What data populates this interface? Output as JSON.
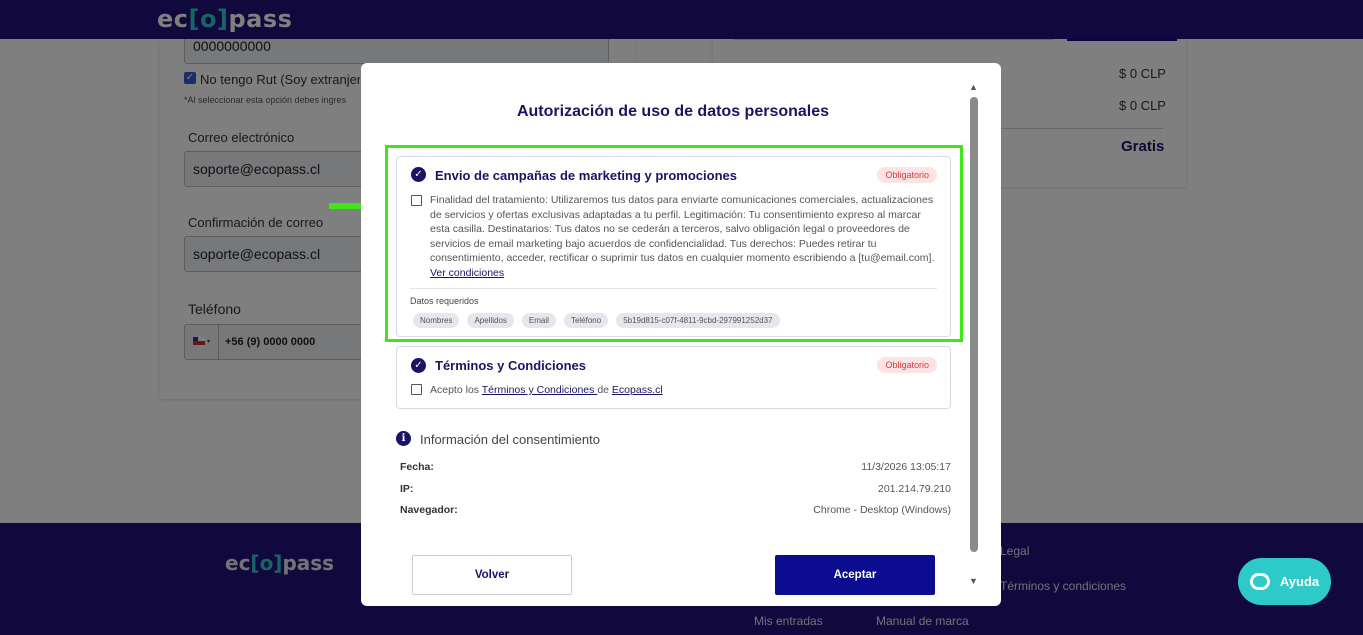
{
  "header": {
    "logo_prefix": "ec",
    "logo_bracket": "[o]",
    "logo_suffix": "pass"
  },
  "background_form": {
    "rut_value": "0000000000",
    "no_rut_label": "No tengo Rut (Soy extranjer",
    "no_rut_note": "*Al seleccionar esta opción debes ingres",
    "email_label": "Correo electrónico",
    "email_value": "soporte@ecopass.cl",
    "email_confirm_label": "Confirmación de correo",
    "email_confirm_value": "soporte@ecopass.cl",
    "phone_label": "Teléfono",
    "phone_value": "+56 (9) 0000 0000"
  },
  "summary": {
    "price_1": "$ 0 CLP",
    "price_2": "$ 0 CLP",
    "total": "Gratis"
  },
  "footer": {
    "logo_prefix": "ec",
    "logo_bracket": "[o]",
    "logo_suffix": "pass",
    "legal_heading": "Legal",
    "terms_link": "Términos y condiciones",
    "my_tickets_link": "Mis entradas",
    "brand_manual_link": "Manual de marca"
  },
  "help_button": {
    "label": "Ayuda"
  },
  "modal": {
    "title": "Autorización de uso de datos personales",
    "marketing": {
      "title": "Envio de campañas de marketing y promociones",
      "badge": "Obligatorio",
      "description": "Finalidad del tratamiento: Utilizaremos tus datos para enviarte comunicaciones comerciales, actualizaciones de servicios y ofertas exclusivas adaptadas a tu perfil. Legitimación: Tu consentimiento expreso al marcar esta casilla. Destinatarios: Tus datos no se cederán a terceros, salvo obligación legal o proveedores de servicios de email marketing bajo acuerdos de confidencialidad. Tus derechos: Puedes retirar tu consentimiento, acceder, rectificar o suprimir tus datos en cualquier momento escribiendo a [tu@email.com].",
      "link": "Ver condiciones",
      "required_label": "Datos requeridos",
      "chips": [
        "Nombres",
        "Apellidos",
        "Email",
        "Teléfono",
        "5b19d815-c07f-4811-9cbd-297991252d37"
      ]
    },
    "terms": {
      "title": "Términos y Condiciones",
      "badge": "Obligatorio",
      "text_prefix": "Acepto los ",
      "link_terms": "Términos y Condiciones ",
      "text_mid": "de ",
      "link_site": "Ecopass.cl"
    },
    "consent_info": {
      "title": "Información del consentimiento",
      "date_label": "Fecha:",
      "date_value": "11/3/2026 13:05:17",
      "ip_label": "IP:",
      "ip_value": "201.214.79.210",
      "browser_label": "Navegador:",
      "browser_value": "Chrome - Desktop (Windows)"
    },
    "back_button": "Volver",
    "accept_button": "Aceptar"
  },
  "colors": {
    "brand_dark": "#23107a",
    "accent_teal": "#2ec9c9",
    "highlight_green": "#3ee61a",
    "accept_blue": "#0b0c8f",
    "badge_red": "#d23c3c"
  }
}
